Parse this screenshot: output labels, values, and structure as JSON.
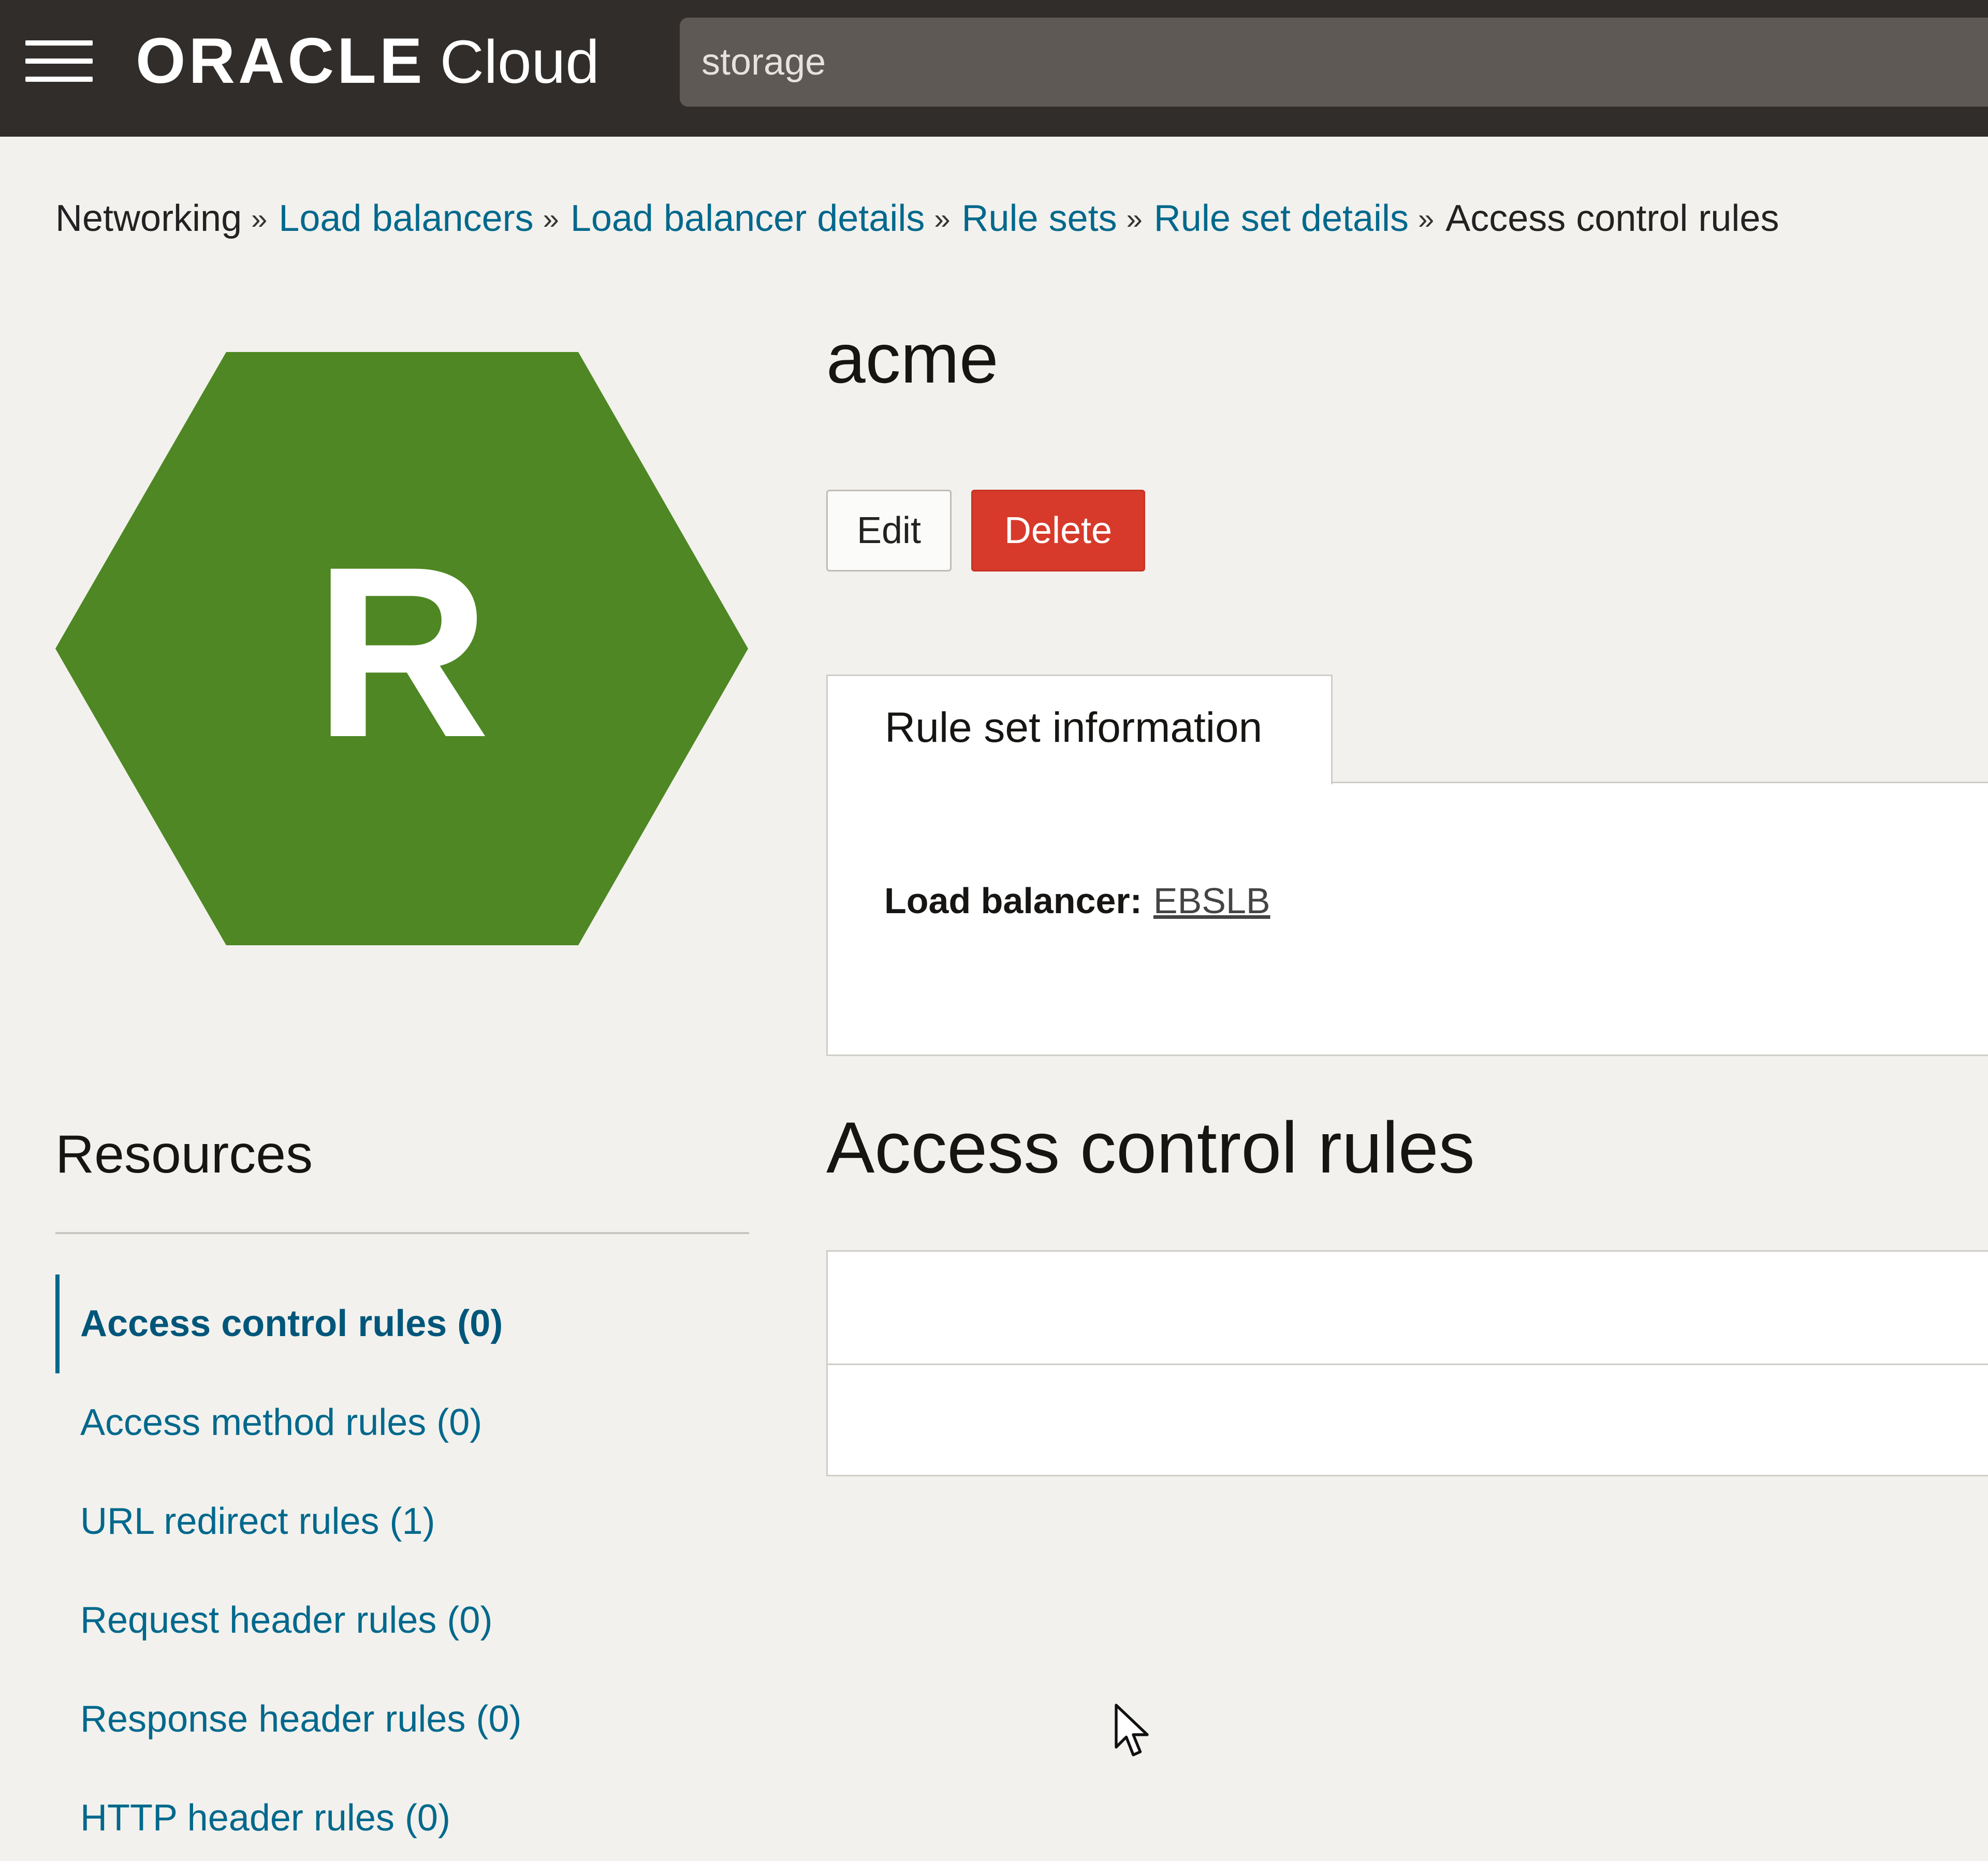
{
  "header": {
    "brand_oracle": "ORACLE",
    "brand_cloud": "Cloud",
    "search_value": "storage"
  },
  "breadcrumb": {
    "items": [
      {
        "label": "Networking",
        "link": false
      },
      {
        "label": "Load balancers",
        "link": true
      },
      {
        "label": "Load balancer details",
        "link": true
      },
      {
        "label": "Rule sets",
        "link": true
      },
      {
        "label": "Rule set details",
        "link": true
      },
      {
        "label": "Access control rules",
        "link": false
      }
    ],
    "separator": "»"
  },
  "resource_icon": {
    "letter": "R",
    "shape": "hexagon",
    "color": "#4e8723"
  },
  "page": {
    "title": "acme",
    "edit_label": "Edit",
    "delete_label": "Delete"
  },
  "info": {
    "tab_label": "Rule set information",
    "load_balancer_label": "Load balancer:",
    "load_balancer_value": "EBSLB"
  },
  "section": {
    "title": "Access control rules"
  },
  "resources": {
    "title": "Resources",
    "items": [
      {
        "label": "Access control rules (0)",
        "active": true
      },
      {
        "label": "Access method rules (0)",
        "active": false
      },
      {
        "label": "URL redirect rules (1)",
        "active": false
      },
      {
        "label": "Request header rules (0)",
        "active": false
      },
      {
        "label": "Response header rules (0)",
        "active": false
      },
      {
        "label": "HTTP header rules (0)",
        "active": false
      }
    ]
  },
  "colors": {
    "topbar": "#312d2a",
    "link": "#00688c",
    "delete": "#d73a2a",
    "hexagon": "#4e8723"
  }
}
